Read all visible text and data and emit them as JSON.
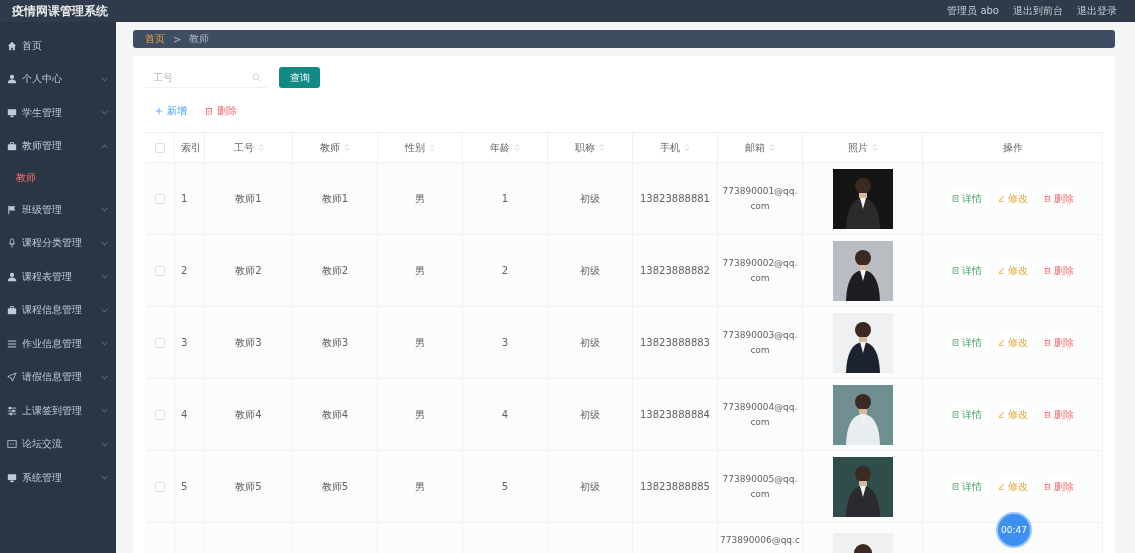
{
  "header": {
    "title": "疫情网课管理系统",
    "user": "管理员 abo",
    "links": [
      "退出到前台",
      "退出登录"
    ]
  },
  "sidebar": {
    "items": [
      {
        "label": "首页",
        "kind": "link"
      },
      {
        "label": "个人中心",
        "kind": "submenu",
        "expanded": false
      },
      {
        "label": "学生管理",
        "kind": "submenu",
        "expanded": false
      },
      {
        "label": "教师管理",
        "kind": "submenu",
        "expanded": true,
        "children": [
          {
            "label": "教师",
            "selected": true
          }
        ]
      },
      {
        "label": "班级管理",
        "kind": "submenu",
        "expanded": false
      },
      {
        "label": "课程分类管理",
        "kind": "submenu",
        "expanded": false
      },
      {
        "label": "课程表管理",
        "kind": "submenu",
        "expanded": false
      },
      {
        "label": "课程信息管理",
        "kind": "submenu",
        "expanded": false
      },
      {
        "label": "作业信息管理",
        "kind": "submenu",
        "expanded": false
      },
      {
        "label": "请假信息管理",
        "kind": "submenu",
        "expanded": false
      },
      {
        "label": "上课签到管理",
        "kind": "submenu",
        "expanded": false
      },
      {
        "label": "论坛交流",
        "kind": "submenu",
        "expanded": false
      },
      {
        "label": "系统管理",
        "kind": "submenu",
        "expanded": false
      }
    ]
  },
  "breadcrumb": {
    "items": [
      "首页",
      "教师"
    ],
    "separator": ">"
  },
  "search": {
    "placeholder": "工号",
    "button": "查询"
  },
  "toolbar": {
    "add": "新增",
    "delete": "删除"
  },
  "table": {
    "select_all_checked": false,
    "columns": [
      {
        "label": "索引",
        "kind": "plain"
      },
      {
        "label": "工号",
        "kind": "sortable"
      },
      {
        "label": "教师",
        "kind": "sortable"
      },
      {
        "label": "性别",
        "kind": "sortable"
      },
      {
        "label": "年龄",
        "kind": "sortable"
      },
      {
        "label": "职称",
        "kind": "sortable"
      },
      {
        "label": "手机",
        "kind": "sortable"
      },
      {
        "label": "邮箱",
        "kind": "sortable"
      },
      {
        "label": "照片",
        "kind": "sortable"
      },
      {
        "label": "操作",
        "kind": "plain"
      }
    ],
    "rows": [
      {
        "checked": false,
        "cells": [
          "1",
          "教师1",
          "教师1",
          "男",
          "1",
          "初级",
          "13823888881",
          "773890001@qq.com"
        ],
        "actions": [
          "详情",
          "修改",
          "删除"
        ]
      },
      {
        "checked": false,
        "cells": [
          "2",
          "教师2",
          "教师2",
          "男",
          "2",
          "初级",
          "13823888882",
          "773890002@qq.com"
        ],
        "actions": [
          "详情",
          "修改",
          "删除"
        ]
      },
      {
        "checked": false,
        "cells": [
          "3",
          "教师3",
          "教师3",
          "男",
          "3",
          "初级",
          "13823888883",
          "773890003@qq.com"
        ],
        "actions": [
          "详情",
          "修改",
          "删除"
        ]
      },
      {
        "checked": false,
        "cells": [
          "4",
          "教师4",
          "教师4",
          "男",
          "4",
          "初级",
          "13823888884",
          "773890004@qq.com"
        ],
        "actions": [
          "详情",
          "修改",
          "删除"
        ]
      },
      {
        "checked": false,
        "cells": [
          "5",
          "教师5",
          "教师5",
          "男",
          "5",
          "初级",
          "13823888885",
          "773890005@qq.com"
        ],
        "actions": [
          "详情",
          "修改",
          "删除"
        ]
      },
      {
        "kind": "partial",
        "email": "773890006@qq.c"
      }
    ]
  },
  "timer": "00:47"
}
